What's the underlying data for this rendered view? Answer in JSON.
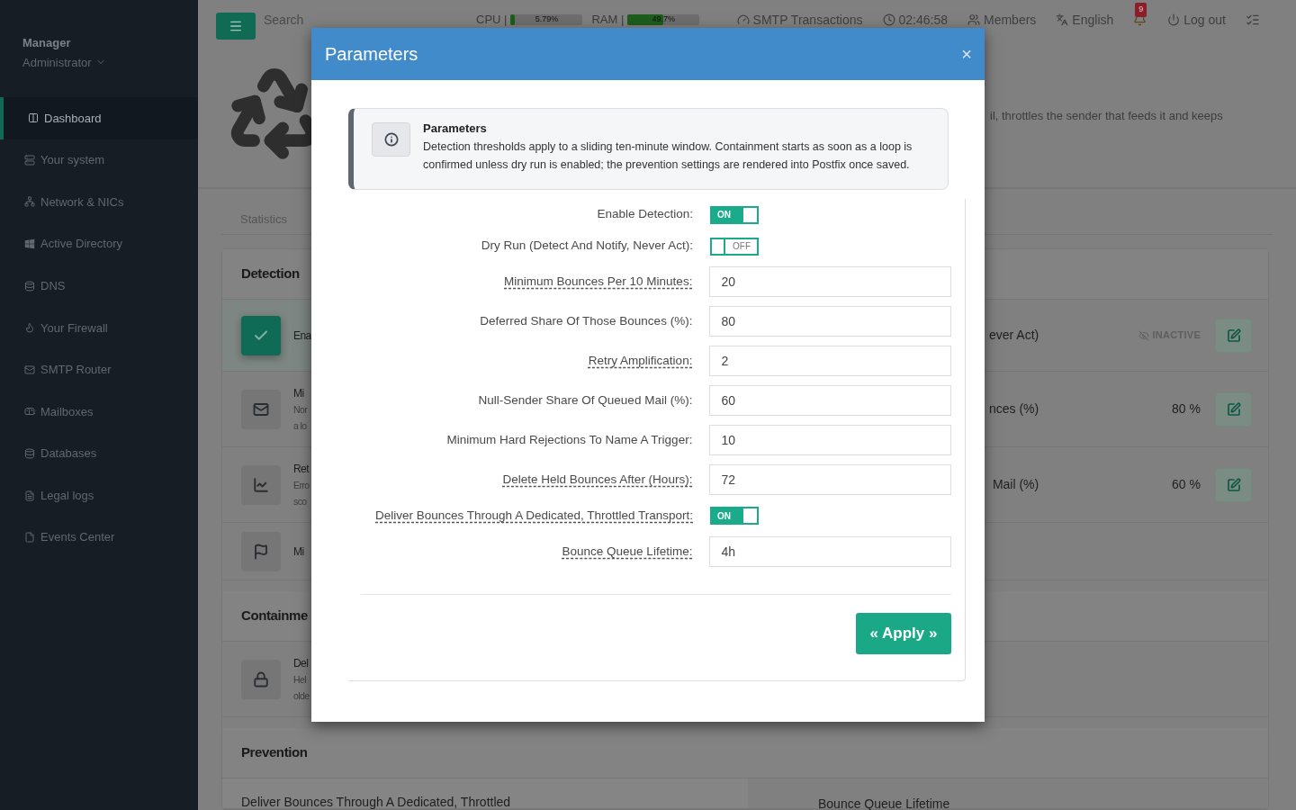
{
  "sidebar": {
    "user": {
      "name": "Manager",
      "role": "Administrator"
    },
    "items": [
      {
        "label": "Dashboard",
        "selected": true
      },
      {
        "label": "Your system",
        "selected": false
      },
      {
        "label": "Network & NICs",
        "selected": false
      },
      {
        "label": "Active Directory",
        "selected": false
      },
      {
        "label": "DNS",
        "selected": false
      },
      {
        "label": "Your Firewall",
        "selected": false
      },
      {
        "label": "SMTP Router",
        "selected": false
      },
      {
        "label": "Mailboxes",
        "selected": false
      },
      {
        "label": "Databases",
        "selected": false
      },
      {
        "label": "Legal logs",
        "selected": false
      },
      {
        "label": "Events Center",
        "selected": false
      }
    ]
  },
  "topbar": {
    "search": {
      "placeholder": "Search"
    },
    "meters": [
      {
        "label": "CPU |",
        "reading": "5.79%",
        "level": 0.0579
      },
      {
        "label": "RAM |",
        "reading": "49.7%",
        "level": 0.497
      }
    ],
    "links": [
      {
        "label": "SMTP Transactions"
      },
      {
        "label": "02:46:58"
      },
      {
        "label": "Members"
      },
      {
        "label": "English"
      }
    ],
    "notifications": {
      "count": "9"
    },
    "logout": "Log out"
  },
  "page": {
    "description": "il, throttles the sender that feeds it and keeps",
    "tabs": [
      {
        "label": "Statistics",
        "selected": false
      }
    ],
    "sections": [
      {
        "title": "Detection",
        "rows": [
          {
            "left": {
              "title": "Ena",
              "on": true
            },
            "right": {
              "title": "ever Act)",
              "status": "INACTIVE"
            }
          },
          {
            "left": {
              "title": "Mi",
              "lines": [
                "Nor",
                "a lo"
              ]
            },
            "right": {
              "title": "nces (%)",
              "value": "80 %"
            }
          },
          {
            "left": {
              "title": "Ret",
              "lines": [
                "Erro",
                "sco"
              ]
            },
            "right": {
              "title": " Mail (%)",
              "value": "60 %"
            }
          },
          {
            "left": {
              "title": "Mi"
            }
          }
        ]
      },
      {
        "title": "Containme",
        "rows": [
          {
            "left": {
              "title": "Del",
              "lines": [
                "Hel",
                "olde"
              ]
            }
          }
        ]
      },
      {
        "title": "Prevention",
        "rows": [
          {
            "left": {
              "title": "Deliver Bounces Through A Dedicated, Throttled"
            },
            "right": {
              "title": "Bounce Queue Lifetime"
            }
          }
        ]
      }
    ]
  },
  "modal": {
    "title": "Parameters",
    "close": "×",
    "info": {
      "title": "Parameters",
      "text": "Detection thresholds apply to a sliding ten-minute window. Containment starts as soon as a loop is confirmed unless dry run is enabled; the prevention settings are rendered into Postfix once saved."
    },
    "fields": [
      {
        "kind": "toggle",
        "label": "Enable Detection:",
        "on": true,
        "switch_text": "ON",
        "has_tooltip": false
      },
      {
        "kind": "toggle",
        "label": "Dry Run (Detect And Notify, Never Act):",
        "on": false,
        "switch_text": "OFF",
        "has_tooltip": false
      },
      {
        "kind": "input",
        "label": "Minimum Bounces Per 10 Minutes:",
        "value": "20",
        "has_tooltip": true
      },
      {
        "kind": "input",
        "label": "Deferred Share Of Those Bounces (%):",
        "value": "80",
        "has_tooltip": false
      },
      {
        "kind": "input",
        "label": "Retry Amplification:",
        "value": "2",
        "has_tooltip": true
      },
      {
        "kind": "input",
        "label": "Null-Sender Share Of Queued Mail (%):",
        "value": "60",
        "has_tooltip": false
      },
      {
        "kind": "input",
        "label": "Minimum Hard Rejections To Name A Trigger:",
        "value": "10",
        "has_tooltip": false
      },
      {
        "kind": "input",
        "label": "Delete Held Bounces After (Hours):",
        "value": "72",
        "has_tooltip": true
      },
      {
        "kind": "toggle",
        "label": "Deliver Bounces Through A Dedicated, Throttled Transport:",
        "on": true,
        "switch_text": "ON",
        "has_tooltip": true
      },
      {
        "kind": "input",
        "label": "Bounce Queue Lifetime:",
        "value": "4h",
        "has_tooltip": true
      }
    ],
    "apply": "« Apply »"
  }
}
